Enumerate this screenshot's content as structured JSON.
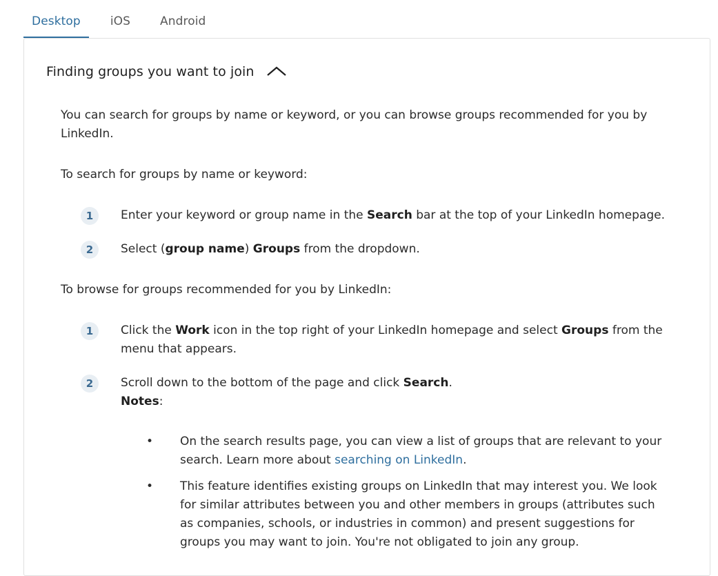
{
  "tabs": [
    {
      "label": "Desktop",
      "active": true
    },
    {
      "label": "iOS",
      "active": false
    },
    {
      "label": "Android",
      "active": false
    }
  ],
  "section": {
    "title": "Finding groups you want to join",
    "toggle_icon": "chevron-up-icon"
  },
  "content": {
    "intro": "You can search for groups by name or keyword, or you can browse groups recommended for you by LinkedIn.",
    "search_heading": "To search for groups by name or keyword:",
    "search_steps": [
      {
        "num": "1",
        "pre": "Enter your keyword or group name in the ",
        "bold": "Search",
        "post": " bar at the top of your LinkedIn homepage."
      },
      {
        "num": "2",
        "pre": "Select ",
        "bold_paren_open": "(",
        "bold1": "group name",
        "bold_paren_close": ")",
        "bold2": "Groups",
        "post": " from the dropdown."
      }
    ],
    "browse_heading": "To browse for groups recommended for you by LinkedIn:",
    "browse_steps": [
      {
        "num": "1",
        "pre": "Click the ",
        "bold1": "Work",
        "mid": " icon in the top right of your LinkedIn homepage and select ",
        "bold2": "Groups",
        "post": " from the menu that appears."
      },
      {
        "num": "2",
        "pre": "Scroll down to the bottom of the page and click ",
        "bold": "Search",
        "post": ".",
        "notes_label": "Notes",
        "notes_colon": ":"
      }
    ],
    "notes": [
      {
        "pre": "On the search results page, you can view a list of groups that are relevant to your search. Learn more about ",
        "link": "searching on LinkedIn",
        "post": "."
      },
      {
        "text": "This feature identifies existing groups on LinkedIn that may interest you. We look for similar attributes between you and other members in groups (attributes such as companies, schools, or industries in common) and present suggestions for groups you may want to join. You're not obligated to join any group."
      }
    ]
  }
}
